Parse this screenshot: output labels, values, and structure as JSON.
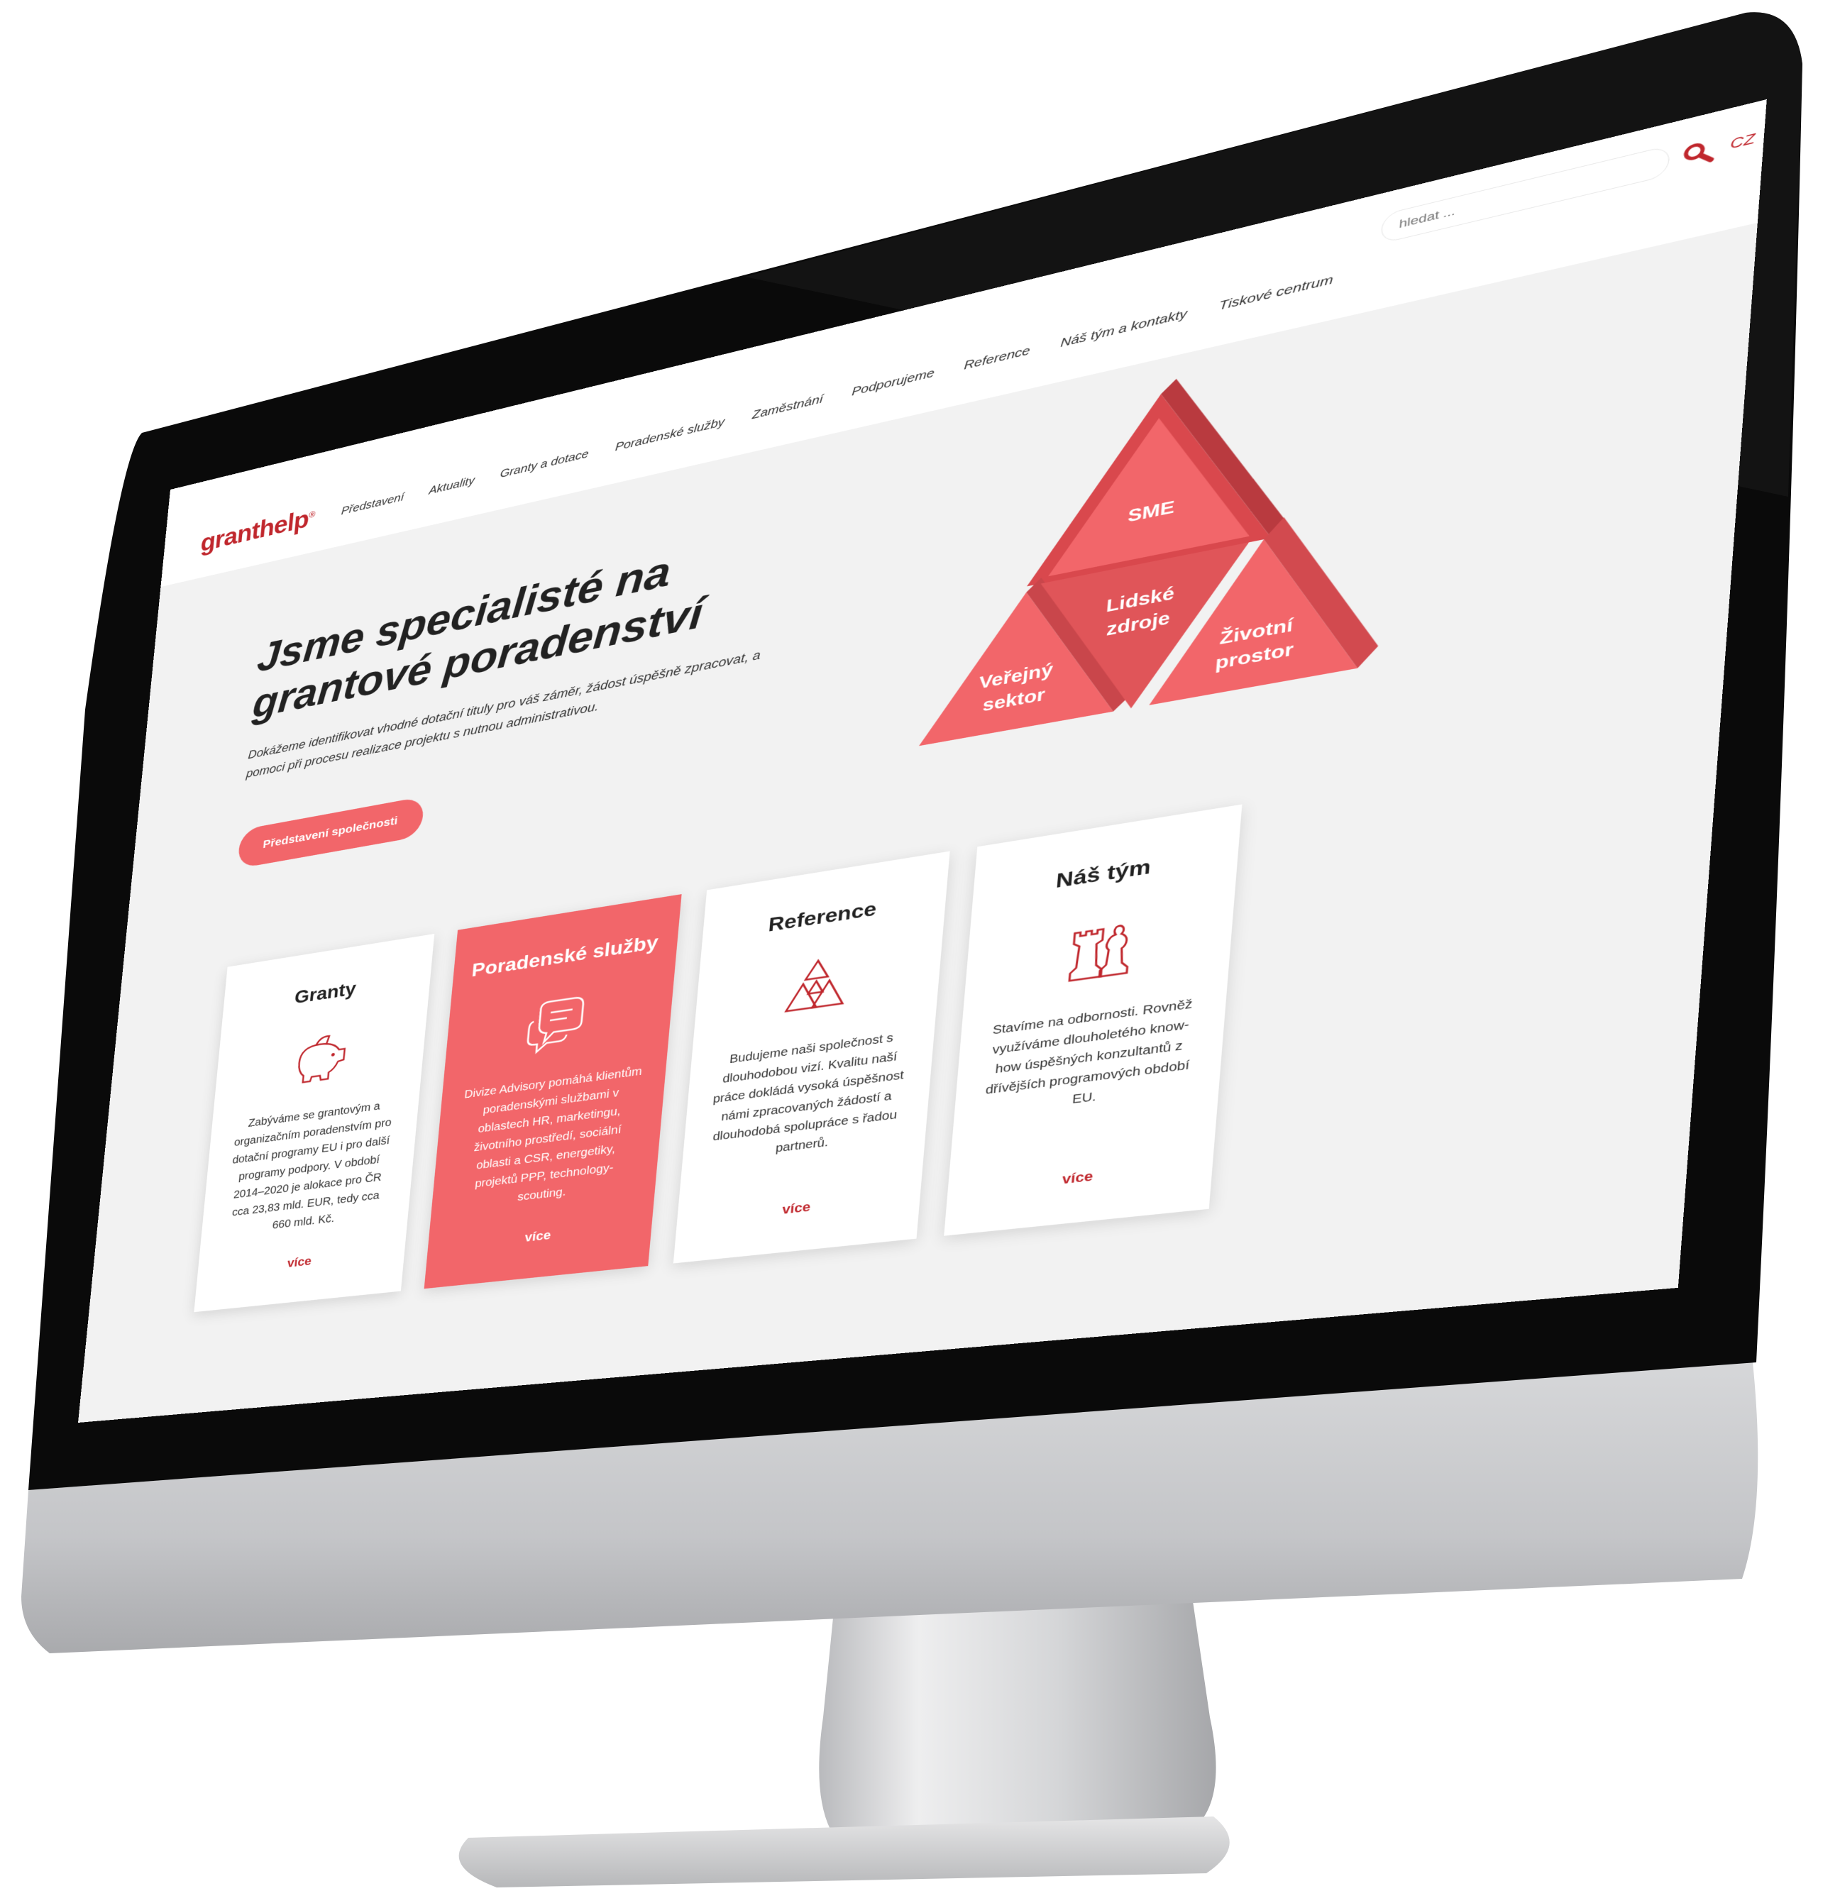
{
  "header": {
    "logo": "granthelp",
    "logo_mark": "®",
    "nav": [
      "Představení",
      "Aktuality",
      "Granty a dotace",
      "Poradenské služby",
      "Zaměstnání",
      "Podporujeme",
      "Reference",
      "Náš tým a kontakty",
      "Tiskové centrum"
    ],
    "search_placeholder": "hledat ...",
    "search_icon": "magnifier-icon",
    "language": "CZ"
  },
  "hero": {
    "title_line1": "Jsme specialisté na",
    "title_line2": "grantové poradenství",
    "subtitle": "Dokážeme identifikovat vhodné dotační tituly pro váš záměr, žádost úspěšně zpracovat, a pomoci při procesu realizace projektu s nutnou administrativou.",
    "button": "Představení společnosti"
  },
  "pyramid": {
    "top": "SME",
    "center_line1": "Lidské",
    "center_line2": "zdroje",
    "left_line1": "Veřejný",
    "left_line2": "sektor",
    "right_line1": "Životní",
    "right_line2": "prostor",
    "color": "#f2666a"
  },
  "cards": [
    {
      "title": "Granty",
      "icon": "piggy-bank-icon",
      "text": "Zabýváme se grantovým a organizačním poradenstvím pro dotační programy EU i pro další programy podpory. V období 2014–2020 je alokace pro ČR cca 23,83 mld. EUR, tedy cca 660 mld. Kč.",
      "more": "více"
    },
    {
      "title": "Poradenské služby",
      "icon": "chat-bubbles-icon",
      "text": "Divize Advisory pomáhá klientům poradenskými službami v oblastech HR, marketingu, životního prostředí, sociální oblasti a CSR, energetiky, projektů PPP, technology-scouting.",
      "more": "více"
    },
    {
      "title": "Reference",
      "icon": "triangles-icon",
      "text": "Budujeme naši společnost s dlouhodobou vizí. Kvalitu naší práce dokládá vysoká úspěšnost námi zpracovaných žádostí a dlouhodobá spolupráce s řadou partnerů.",
      "more": "více"
    },
    {
      "title": "Náš tým",
      "icon": "chess-pieces-icon",
      "text": "Stavíme na odbornosti. Rovněž využíváme dlouholetého know-how úspěšných konzultantů z dřívějších programových období EU.",
      "more": "více"
    }
  ],
  "colors": {
    "accent": "#f2666a",
    "brand_red": "#c0272d",
    "page_bg": "#f2f2f2",
    "bezel": "#0a0a0a",
    "chin": "#c9cacc"
  }
}
